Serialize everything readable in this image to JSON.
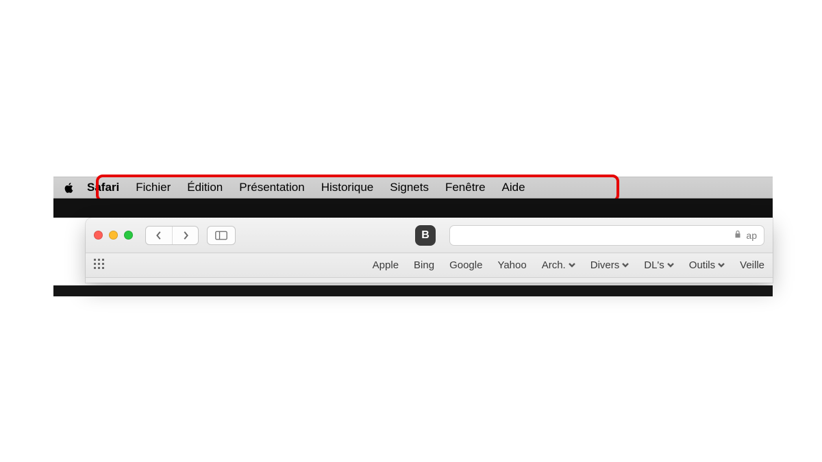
{
  "menubar": {
    "items": [
      {
        "label": "Safari",
        "bold": true
      },
      {
        "label": "Fichier"
      },
      {
        "label": "Édition"
      },
      {
        "label": "Présentation"
      },
      {
        "label": "Historique"
      },
      {
        "label": "Signets"
      },
      {
        "label": "Fenêtre"
      },
      {
        "label": "Aide"
      }
    ]
  },
  "toolbar": {
    "badge_letter": "B",
    "url_text": "ap"
  },
  "bookmarks": {
    "items": [
      {
        "label": "Apple",
        "dropdown": false
      },
      {
        "label": "Bing",
        "dropdown": false
      },
      {
        "label": "Google",
        "dropdown": false
      },
      {
        "label": "Yahoo",
        "dropdown": false
      },
      {
        "label": "Arch.",
        "dropdown": true
      },
      {
        "label": "Divers",
        "dropdown": true
      },
      {
        "label": "DL's",
        "dropdown": true
      },
      {
        "label": "Outils",
        "dropdown": true
      },
      {
        "label": "Veille",
        "dropdown": false
      }
    ]
  }
}
